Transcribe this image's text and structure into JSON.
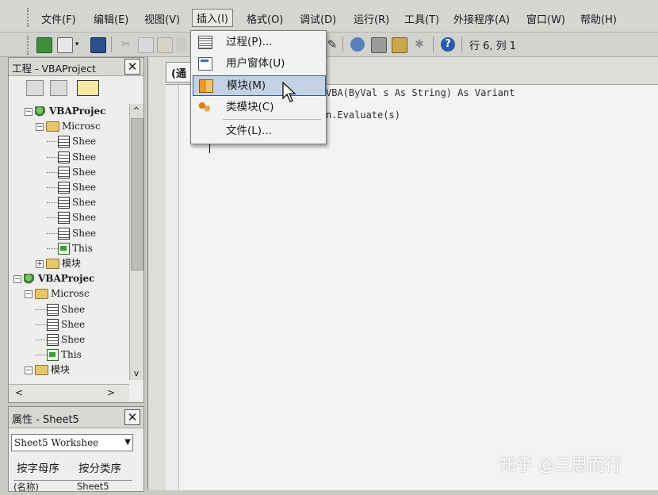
{
  "menubar": {
    "items": [
      {
        "label": "文件(F)"
      },
      {
        "label": "编辑(E)"
      },
      {
        "label": "视图(V)"
      },
      {
        "label": "插入(I)"
      },
      {
        "label": "格式(O)"
      },
      {
        "label": "调试(D)"
      },
      {
        "label": "运行(R)"
      },
      {
        "label": "工具(T)"
      },
      {
        "label": "外接程序(A)"
      },
      {
        "label": "窗口(W)"
      },
      {
        "label": "帮助(H)"
      }
    ]
  },
  "toolbar": {
    "position_text": "行 6, 列 1"
  },
  "insert_menu": {
    "items": [
      {
        "label": "过程(P)...",
        "icon": "procedure-icon"
      },
      {
        "label": "用户窗体(U)",
        "icon": "userform-icon"
      },
      {
        "label": "模块(M)",
        "icon": "module-icon",
        "highlighted": true
      },
      {
        "label": "类模块(C)",
        "icon": "class-module-icon"
      },
      {
        "label": "文件(L)...",
        "icon": "file-icon"
      }
    ]
  },
  "project_pane": {
    "title": "工程 - VBAProject",
    "tree": [
      {
        "label": "VBAProjec",
        "type": "project",
        "expander": "−"
      },
      {
        "label": "Microsc",
        "type": "folder",
        "expander": "−"
      },
      {
        "label": "Shee",
        "type": "sheet"
      },
      {
        "label": "Shee",
        "type": "sheet"
      },
      {
        "label": "Shee",
        "type": "sheet"
      },
      {
        "label": "Shee",
        "type": "sheet"
      },
      {
        "label": "Shee",
        "type": "sheet"
      },
      {
        "label": "Shee",
        "type": "sheet"
      },
      {
        "label": "Shee",
        "type": "sheet"
      },
      {
        "label": "This",
        "type": "workbook"
      },
      {
        "label": "模块",
        "type": "folder",
        "expander": "+"
      },
      {
        "label": "VBAProjec",
        "type": "project",
        "expander": "−"
      },
      {
        "label": "Microsc",
        "type": "folder",
        "expander": "−"
      },
      {
        "label": "Shee",
        "type": "sheet"
      },
      {
        "label": "Shee",
        "type": "sheet"
      },
      {
        "label": "Shee",
        "type": "sheet"
      },
      {
        "label": "This",
        "type": "workbook"
      },
      {
        "label": "模块",
        "type": "folder",
        "expander": "−"
      }
    ]
  },
  "properties_pane": {
    "title": "属性 - Sheet5",
    "object_select": "Sheet5 Workshee",
    "tabs": [
      "按字母序",
      "按分类序"
    ],
    "first_row": {
      "name": "(名称)",
      "value": "Sheet5"
    }
  },
  "code_window": {
    "object_combo": "(通",
    "lines": [
      "VBA(ByVal s As String) As Variant",
      "n.Evaluate(s)"
    ]
  },
  "watermark": "知乎 @三思而行"
}
